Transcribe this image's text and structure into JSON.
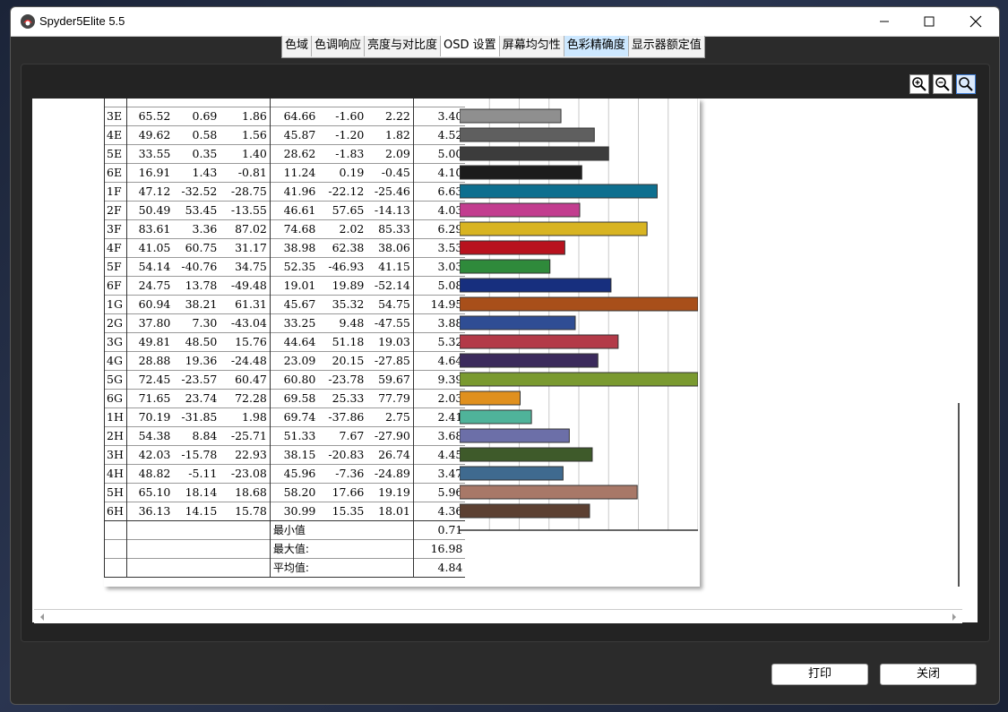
{
  "window": {
    "title": "Spyder5Elite 5.5"
  },
  "tabs": [
    {
      "label": "色域"
    },
    {
      "label": "色调响应"
    },
    {
      "label": "亮度与对比度"
    },
    {
      "label": "OSD 设置"
    },
    {
      "label": "屏幕均匀性"
    },
    {
      "label": "色彩精确度"
    },
    {
      "label": "显示器额定值"
    }
  ],
  "selected_tab": "色彩精确度",
  "rows": [
    {
      "id": "3E",
      "v": [
        "65.52",
        "0.69",
        "1.86",
        "64.66",
        "-1.60",
        "2.22",
        "3.40"
      ],
      "de": 3.4,
      "color": "#8f8f8f"
    },
    {
      "id": "4E",
      "v": [
        "49.62",
        "0.58",
        "1.56",
        "45.87",
        "-1.20",
        "1.82",
        "4.52"
      ],
      "de": 4.52,
      "color": "#5f5f5f"
    },
    {
      "id": "5E",
      "v": [
        "33.55",
        "0.35",
        "1.40",
        "28.62",
        "-1.83",
        "2.09",
        "5.00"
      ],
      "de": 5.0,
      "color": "#3c3c3c"
    },
    {
      "id": "6E",
      "v": [
        "16.91",
        "1.43",
        "-0.81",
        "11.24",
        "0.19",
        "-0.45",
        "4.10"
      ],
      "de": 4.1,
      "color": "#1c1c1c"
    },
    {
      "id": "1F",
      "v": [
        "47.12",
        "-32.52",
        "-28.75",
        "41.96",
        "-22.12",
        "-25.46",
        "6.63"
      ],
      "de": 6.63,
      "color": "#0e6f8f"
    },
    {
      "id": "2F",
      "v": [
        "50.49",
        "53.45",
        "-13.55",
        "46.61",
        "57.65",
        "-14.13",
        "4.03"
      ],
      "de": 4.03,
      "color": "#c23d8f"
    },
    {
      "id": "3F",
      "v": [
        "83.61",
        "3.36",
        "87.02",
        "74.68",
        "2.02",
        "85.33",
        "6.29"
      ],
      "de": 6.29,
      "color": "#d8b422"
    },
    {
      "id": "4F",
      "v": [
        "41.05",
        "60.75",
        "31.17",
        "38.98",
        "62.38",
        "38.06",
        "3.53"
      ],
      "de": 3.53,
      "color": "#b8121e"
    },
    {
      "id": "5F",
      "v": [
        "54.14",
        "-40.76",
        "34.75",
        "52.35",
        "-46.93",
        "41.15",
        "3.03"
      ],
      "de": 3.03,
      "color": "#2f8a3b"
    },
    {
      "id": "6F",
      "v": [
        "24.75",
        "13.78",
        "-49.48",
        "19.01",
        "19.89",
        "-52.14",
        "5.08"
      ],
      "de": 5.08,
      "color": "#172f7e"
    },
    {
      "id": "1G",
      "v": [
        "60.94",
        "38.21",
        "61.31",
        "45.67",
        "35.32",
        "54.75",
        "14.95"
      ],
      "de": 14.95,
      "color": "#a84f1a"
    },
    {
      "id": "2G",
      "v": [
        "37.80",
        "7.30",
        "-43.04",
        "33.25",
        "9.48",
        "-47.55",
        "3.88"
      ],
      "de": 3.88,
      "color": "#2f4d94"
    },
    {
      "id": "3G",
      "v": [
        "49.81",
        "48.50",
        "15.76",
        "44.64",
        "51.18",
        "19.03",
        "5.32"
      ],
      "de": 5.32,
      "color": "#b33a48"
    },
    {
      "id": "4G",
      "v": [
        "28.88",
        "19.36",
        "-24.48",
        "23.09",
        "20.15",
        "-27.85",
        "4.64"
      ],
      "de": 4.64,
      "color": "#3b2a5c"
    },
    {
      "id": "5G",
      "v": [
        "72.45",
        "-23.57",
        "60.47",
        "60.80",
        "-23.78",
        "59.67",
        "9.39"
      ],
      "de": 9.39,
      "color": "#7a9a30"
    },
    {
      "id": "6G",
      "v": [
        "71.65",
        "23.74",
        "72.28",
        "69.58",
        "25.33",
        "77.79",
        "2.03"
      ],
      "de": 2.03,
      "color": "#e0901e"
    },
    {
      "id": "1H",
      "v": [
        "70.19",
        "-31.85",
        "1.98",
        "69.74",
        "-37.86",
        "2.75",
        "2.41"
      ],
      "de": 2.41,
      "color": "#4fb39a"
    },
    {
      "id": "2H",
      "v": [
        "54.38",
        "8.84",
        "-25.71",
        "51.33",
        "7.67",
        "-27.90",
        "3.68"
      ],
      "de": 3.68,
      "color": "#6c6fa8"
    },
    {
      "id": "3H",
      "v": [
        "42.03",
        "-15.78",
        "22.93",
        "38.15",
        "-20.83",
        "26.74",
        "4.45"
      ],
      "de": 4.45,
      "color": "#3e5a2a"
    },
    {
      "id": "4H",
      "v": [
        "48.82",
        "-5.11",
        "-23.08",
        "45.96",
        "-7.36",
        "-24.89",
        "3.47"
      ],
      "de": 3.47,
      "color": "#3f6a8f"
    },
    {
      "id": "5H",
      "v": [
        "65.10",
        "18.14",
        "18.68",
        "58.20",
        "17.66",
        "19.19",
        "5.96"
      ],
      "de": 5.96,
      "color": "#a87868"
    },
    {
      "id": "6H",
      "v": [
        "36.13",
        "14.15",
        "15.78",
        "30.99",
        "15.35",
        "18.01",
        "4.36"
      ],
      "de": 4.36,
      "color": "#5c4032"
    }
  ],
  "summary": [
    {
      "label": "最小值",
      "value": "0.71"
    },
    {
      "label": "最大值:",
      "value": "16.98"
    },
    {
      "label": "平均值:",
      "value": "4.84"
    }
  ],
  "chart_data": {
    "type": "bar",
    "categories": [
      "3E",
      "4E",
      "5E",
      "6E",
      "1F",
      "2F",
      "3F",
      "4F",
      "5F",
      "6F",
      "1G",
      "2G",
      "3G",
      "4G",
      "5G",
      "6G",
      "1H",
      "2H",
      "3H",
      "4H",
      "5H",
      "6H"
    ],
    "values": [
      3.4,
      4.52,
      5.0,
      4.1,
      6.63,
      4.03,
      6.29,
      3.53,
      3.03,
      5.08,
      14.95,
      3.88,
      5.32,
      4.64,
      9.39,
      2.03,
      2.41,
      3.68,
      4.45,
      3.47,
      5.96,
      4.36
    ],
    "xlim": [
      0,
      8
    ]
  },
  "buttons": {
    "print": "打印",
    "close": "关闭"
  }
}
